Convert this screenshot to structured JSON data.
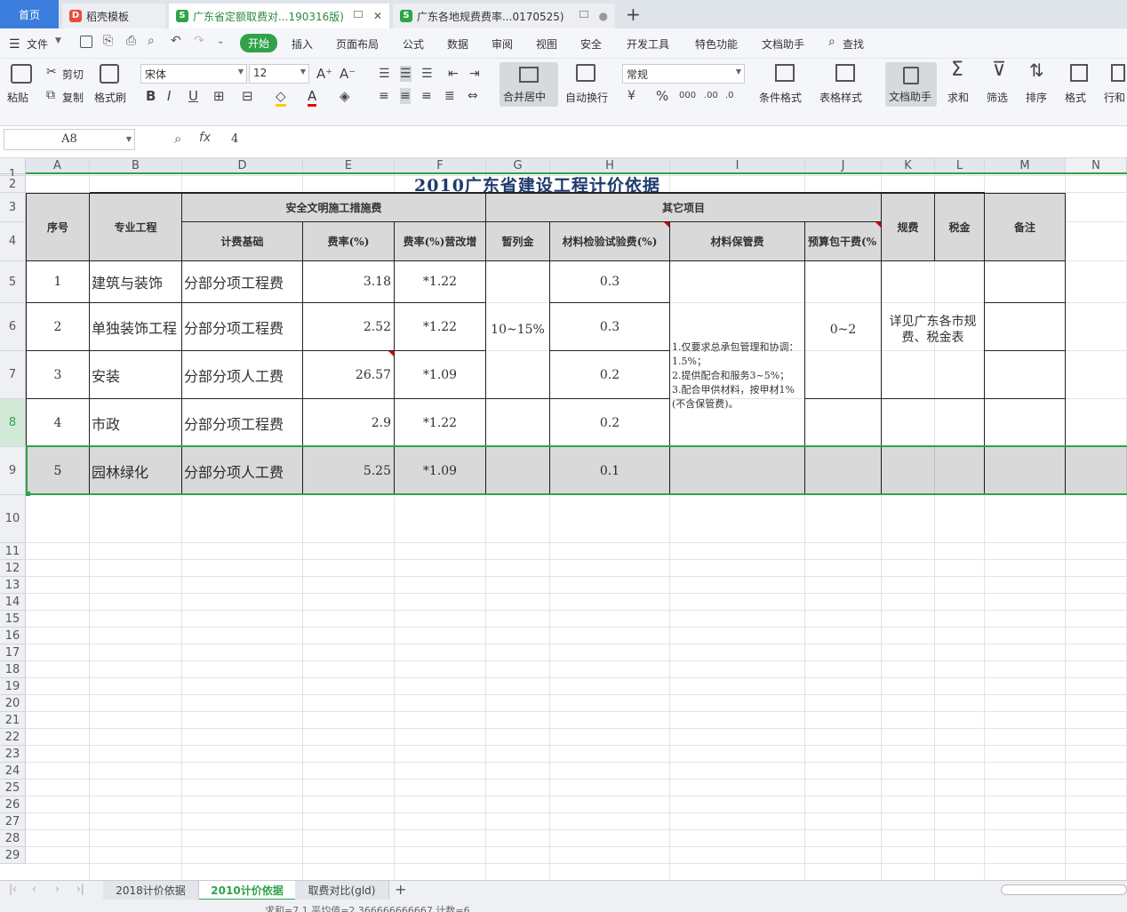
{
  "tabs": [
    {
      "label": "首页"
    },
    {
      "label": "稻壳模板"
    },
    {
      "label": "广东省定额取费对...190316版)"
    },
    {
      "label": "广东各地规费费率...0170525)"
    }
  ],
  "menu": [
    "文件",
    "开始",
    "插入",
    "页面布局",
    "公式",
    "数据",
    "审阅",
    "视图",
    "安全",
    "开发工具",
    "特色功能",
    "文档助手",
    "查找"
  ],
  "ribbon": {
    "paste": "粘贴",
    "cut": "剪切",
    "copy": "复制",
    "format_painter": "格式刷",
    "font_name": "宋体",
    "font_size": "12",
    "merge": "合并居中",
    "wrap": "自动换行",
    "number_format": "常规",
    "cond_format": "条件格式",
    "table_style": "表格样式",
    "doc_helper": "文档助手",
    "sum": "求和",
    "filter": "筛选",
    "sort": "排序",
    "format": "格式",
    "rowcol": "行和"
  },
  "formula": {
    "cell_ref": "A8",
    "fx": "fx",
    "value": "4"
  },
  "columns": [
    "A",
    "B",
    "D",
    "E",
    "F",
    "G",
    "H",
    "I",
    "J",
    "K",
    "L",
    "M",
    "N"
  ],
  "rows": [
    "1",
    "2",
    "3",
    "4",
    "5",
    "6",
    "7",
    "8",
    "9",
    "10",
    "11",
    "12",
    "13",
    "14",
    "15",
    "16",
    "17",
    "18",
    "19",
    "20",
    "21",
    "22",
    "23",
    "24",
    "25",
    "26",
    "27",
    "28",
    "29"
  ],
  "sheet": {
    "title": "2010广东省建设工程计价依据",
    "headers": {
      "seq": "序号",
      "major": "专业工程",
      "safety": "安全文明施工措施费",
      "other": "其它项目",
      "base": "计费基础",
      "rate": "费率(%)",
      "rate_vat": "费率(%)营改增",
      "provisional": "暂列金",
      "test_fee": "材料检验试验费(%)",
      "storage": "材料保管费",
      "contract": "预算包干费(%",
      "gui_fee": "规费",
      "tax": "税金",
      "note": "备注"
    },
    "data_rows": [
      {
        "seq": "1",
        "major": "建筑与装饰",
        "base": "分部分项工程费",
        "rate": "3.18",
        "vat": "*1.22",
        "test": "0.3"
      },
      {
        "seq": "2",
        "major": "单独装饰工程",
        "base": "分部分项工程费",
        "rate": "2.52",
        "vat": "*1.22",
        "test": "0.3"
      },
      {
        "seq": "3",
        "major": "安装",
        "base": "分部分项人工费",
        "rate": "26.57",
        "vat": "*1.09",
        "test": "0.2"
      },
      {
        "seq": "4",
        "major": "市政",
        "base": "分部分项工程费",
        "rate": "2.9",
        "vat": "*1.22",
        "test": "0.2"
      },
      {
        "seq": "5",
        "major": "园林绿化",
        "base": "分部分项人工费",
        "rate": "5.25",
        "vat": "*1.09",
        "test": "0.1"
      }
    ],
    "provisional_value": "10~15%",
    "storage_text": "1.仅要求总承包管理和协调：1.5%；\n2.提供配合和服务3~5%；\n3.配合甲供材料，按甲材1%(不含保管费)。",
    "contract_value": "0~2",
    "gui_text": "详见广东各市规费、税金表"
  },
  "sheet_tabs": [
    "2018计价依据",
    "2010计价依据",
    "取费对比(gld)"
  ],
  "status": "求和=7.1  平均值=2.366666666667  计数=6"
}
